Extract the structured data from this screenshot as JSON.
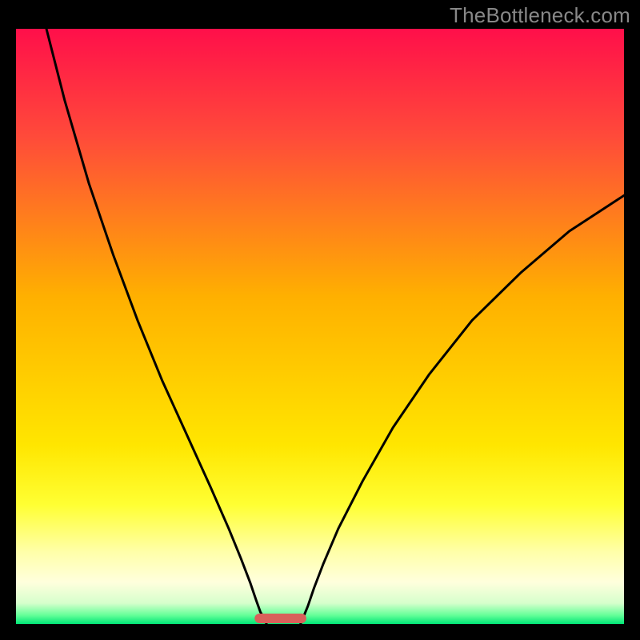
{
  "watermark": "TheBottleneck.com",
  "chart_data": {
    "type": "line",
    "title": "",
    "xlabel": "",
    "ylabel": "",
    "xlim": [
      0,
      100
    ],
    "ylim": [
      0,
      100
    ],
    "background_gradient": {
      "stops": [
        {
          "offset": 0.0,
          "color": "#ff0f4a"
        },
        {
          "offset": 0.18,
          "color": "#ff4a3a"
        },
        {
          "offset": 0.45,
          "color": "#ffb000"
        },
        {
          "offset": 0.7,
          "color": "#ffe600"
        },
        {
          "offset": 0.8,
          "color": "#ffff33"
        },
        {
          "offset": 0.88,
          "color": "#ffffaa"
        },
        {
          "offset": 0.93,
          "color": "#ffffdd"
        },
        {
          "offset": 0.965,
          "color": "#d6ffcc"
        },
        {
          "offset": 0.985,
          "color": "#66ff99"
        },
        {
          "offset": 1.0,
          "color": "#00e676"
        }
      ]
    },
    "series": [
      {
        "name": "left-branch",
        "x": [
          5,
          8,
          12,
          16,
          20,
          24,
          28,
          32,
          35,
          37,
          38.5,
          39.5,
          40.2,
          40.8,
          41.2
        ],
        "y": [
          100,
          88,
          74,
          62,
          51,
          41,
          32,
          23,
          16,
          11,
          7,
          4,
          2,
          1,
          0
        ]
      },
      {
        "name": "right-branch",
        "x": [
          46.8,
          47.2,
          48,
          49,
          50.5,
          53,
          57,
          62,
          68,
          75,
          83,
          91,
          100
        ],
        "y": [
          0,
          1,
          3,
          6,
          10,
          16,
          24,
          33,
          42,
          51,
          59,
          66,
          72
        ]
      }
    ],
    "marker": {
      "name": "optimal-range",
      "shape": "rounded-bar",
      "x_center": 43.5,
      "width": 8.5,
      "y": 0,
      "color": "#d9605a"
    }
  }
}
